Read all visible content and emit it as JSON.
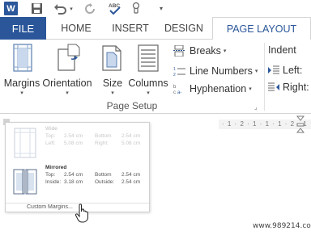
{
  "qat": {
    "app_icon_label": "W",
    "icons": [
      "word-icon",
      "save-icon",
      "undo-icon",
      "redo-icon",
      "spelling-abc-icon",
      "touch-mode-icon",
      "customize-qat-icon"
    ],
    "spelling_label": "ABC"
  },
  "tabs": {
    "file": "FILE",
    "home": "HOME",
    "insert": "INSERT",
    "design": "DESIGN",
    "page_layout": "PAGE LAYOUT"
  },
  "ribbon": {
    "margins": "Margins",
    "orientation": "Orientation",
    "size": "Size",
    "columns": "Columns",
    "breaks": "Breaks",
    "line_numbers": "Line Numbers",
    "hyphenation": "Hyphenation",
    "group_label": "Page Setup",
    "indent_title": "Indent",
    "indent_left": "Left:",
    "indent_right": "Right:"
  },
  "gallery": {
    "wide": {
      "title": "Wide",
      "top_label": "Top:",
      "top_value": "2.54 cm",
      "left_label": "Left:",
      "left_value": "5.08 cm",
      "bottom_label": "Bottom",
      "bottom_value": "2.54 cm",
      "right_label": "Right:",
      "right_value": "5.08 cm"
    },
    "mirrored": {
      "title": "Mirrored",
      "top_label": "Top:",
      "top_value": "2.54 cm",
      "inside_label": "Inside:",
      "inside_value": "3.18 cm",
      "bottom_label": "Bottom",
      "bottom_value": "2.54 cm",
      "outside_label": "Outside:",
      "outside_value": "2.54 cm"
    },
    "custom_margins": "Custom Margins..."
  },
  "ruler": {
    "text": "· 1 · 2 · 1 · 1 · 1 · 2 · 1"
  },
  "watermark": "www.989214.com",
  "colors": {
    "accent": "#2b579a",
    "ribbon_bg": "#ffffff",
    "border": "#d5d5d5"
  }
}
